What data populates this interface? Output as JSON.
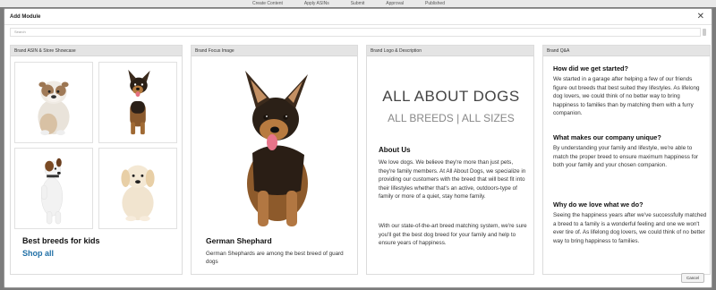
{
  "background": {
    "tabs": [
      "Create Content",
      "Apply ASINs",
      "Submit",
      "Approval",
      "Published"
    ]
  },
  "modal": {
    "title": "Add Module",
    "search_placeholder": "Search",
    "cancel_label": "Cancel"
  },
  "panels": {
    "showcase": {
      "header": "Brand ASIN & Store Showcase",
      "heading": "Best breeds for kids",
      "link": "Shop all"
    },
    "focus": {
      "header": "Brand Focus Image",
      "title": "German Shephard",
      "text": "German Shephards are among the best breed of guard dogs"
    },
    "logo": {
      "header": "Brand Logo & Description",
      "title": "ALL ABOUT DOGS",
      "subtitle": "ALL BREEDS | ALL SIZES",
      "about_heading": "About Us",
      "about_text": "We love dogs. We believe they're more than just pets, they're family members. At All About Dogs, we specialize in providing our customers with the breed that will best fit into their lifestyles whether that's an active, outdoors-type of family or more of a quiet, stay home family.",
      "about_text_2": "With our state-of-the-art breed matching system, we're sure you'll get the best dog breed for your family and help to ensure years of happiness."
    },
    "qa": {
      "header": "Brand Q&A",
      "items": [
        {
          "q": "How did we get started?",
          "a": "We started in a garage after helping a few of our friends figure out breeds that best suited they lifestyles. As lifelong dog lovers, we could think of no better way to bring happiness to families than by matching them with a furry companion."
        },
        {
          "q": "What makes our company unique?",
          "a": "By understanding your family and lifestyle, we're able to match the proper breed to ensure maximum happiness for both your family and your chosen companion."
        },
        {
          "q": "Why do we love what we do?",
          "a": "Seeing the happiness years after we've successfully matched a breed to a family is a wonderful feeling and one we won't ever tire of. As lifelong dog lovers, we could think of no better way to bring happiness to families."
        }
      ]
    }
  }
}
